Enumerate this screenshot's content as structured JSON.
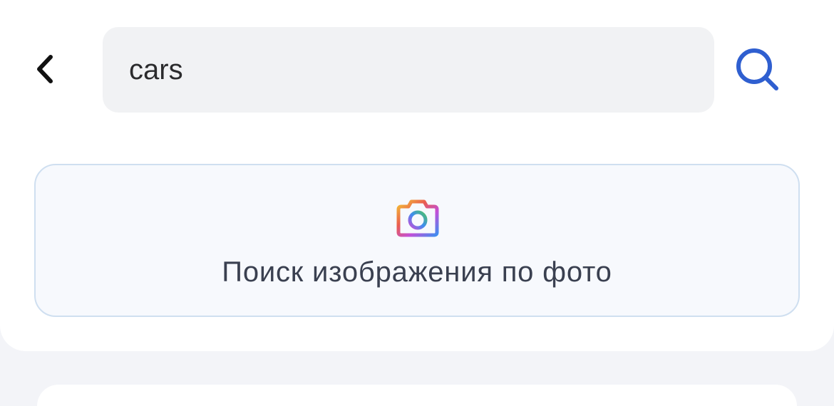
{
  "header": {
    "back_icon": "chevron-left-icon",
    "search": {
      "value": "cars",
      "placeholder": ""
    },
    "search_icon": "search-icon"
  },
  "photo_search": {
    "icon": "camera-icon",
    "label": "Поиск изображения по фото"
  },
  "colors": {
    "accent": "#2f5fd0",
    "background": "#f3f4f8",
    "card": "#ffffff",
    "input_bg": "#f1f2f4",
    "photo_border": "#cfdff0",
    "text": "#3a4050"
  }
}
